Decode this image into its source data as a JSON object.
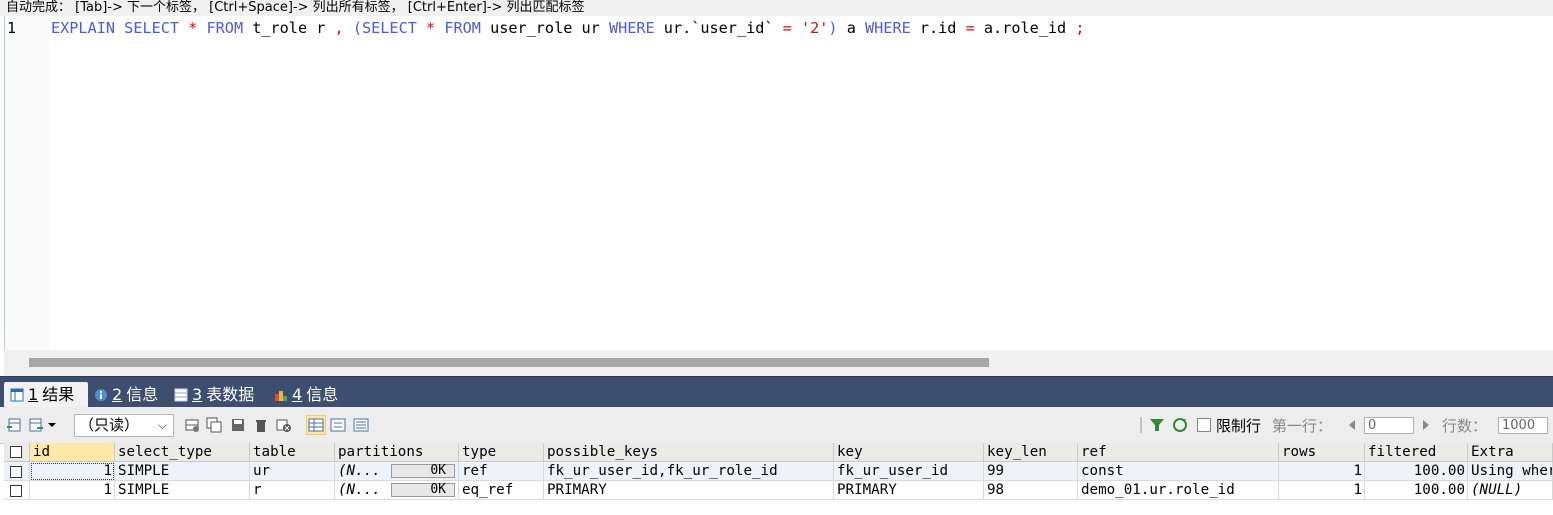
{
  "hint_bar": {
    "text": "自动完成： [Tab]-> 下一个标签， [Ctrl+Space]-> 列出所有标签， [Ctrl+Enter]-> 列出匹配标签"
  },
  "editor": {
    "line_number": "1",
    "tokens": [
      {
        "t": "EXPLAIN",
        "c": "kw"
      },
      {
        "t": " ",
        "c": "id"
      },
      {
        "t": "SELECT",
        "c": "kw"
      },
      {
        "t": " ",
        "c": "id"
      },
      {
        "t": "*",
        "c": "op"
      },
      {
        "t": " ",
        "c": "id"
      },
      {
        "t": "FROM",
        "c": "kw"
      },
      {
        "t": " t_role r ",
        "c": "id"
      },
      {
        "t": ",",
        "c": "op"
      },
      {
        "t": " ",
        "c": "id"
      },
      {
        "t": "(",
        "c": "paren"
      },
      {
        "t": "SELECT",
        "c": "kw"
      },
      {
        "t": " ",
        "c": "id"
      },
      {
        "t": "*",
        "c": "op"
      },
      {
        "t": " ",
        "c": "id"
      },
      {
        "t": "FROM",
        "c": "kw"
      },
      {
        "t": " user_role ur ",
        "c": "id"
      },
      {
        "t": "WHERE",
        "c": "kw"
      },
      {
        "t": " ur.`user_id` ",
        "c": "id"
      },
      {
        "t": "=",
        "c": "op"
      },
      {
        "t": " ",
        "c": "id"
      },
      {
        "t": "'2'",
        "c": "str"
      },
      {
        "t": ")",
        "c": "paren"
      },
      {
        "t": " a ",
        "c": "id"
      },
      {
        "t": "WHERE",
        "c": "kw"
      },
      {
        "t": " r.id ",
        "c": "id"
      },
      {
        "t": "=",
        "c": "op"
      },
      {
        "t": " a.role_id ",
        "c": "id"
      },
      {
        "t": ";",
        "c": "op"
      }
    ]
  },
  "tabs": [
    {
      "num": "1",
      "label": "结果"
    },
    {
      "num": "2",
      "label": "信息"
    },
    {
      "num": "3",
      "label": "表数据"
    },
    {
      "num": "4",
      "label": "信息"
    }
  ],
  "toolbar": {
    "readonly_select": "（只读）",
    "limit_label": "限制行",
    "first_row_label": "第一行：",
    "first_row_value": "0",
    "row_count_label": "行数：",
    "row_count_value": "1000"
  },
  "grid": {
    "columns": [
      "id",
      "select_type",
      "table",
      "partitions",
      "type",
      "possible_keys",
      "key",
      "key_len",
      "ref",
      "rows",
      "filtered",
      "Extra"
    ],
    "rows": [
      {
        "id": "1",
        "select_type": "SIMPLE",
        "table": "ur",
        "partitions": "(N...",
        "partitions_size": "0K",
        "type": "ref",
        "possible_keys": "fk_ur_user_id,fk_ur_role_id",
        "key": "fk_ur_user_id",
        "key_len": "99",
        "ref": "const",
        "rows": "1",
        "filtered": "100.00",
        "Extra": "Using where"
      },
      {
        "id": "1",
        "select_type": "SIMPLE",
        "table": "r",
        "partitions": "(N...",
        "partitions_size": "0K",
        "type": "eq_ref",
        "possible_keys": "PRIMARY",
        "key": "PRIMARY",
        "key_len": "98",
        "ref": "demo_01.ur.role_id",
        "rows": "1",
        "filtered": "100.00",
        "Extra": "(NULL)"
      }
    ]
  }
}
